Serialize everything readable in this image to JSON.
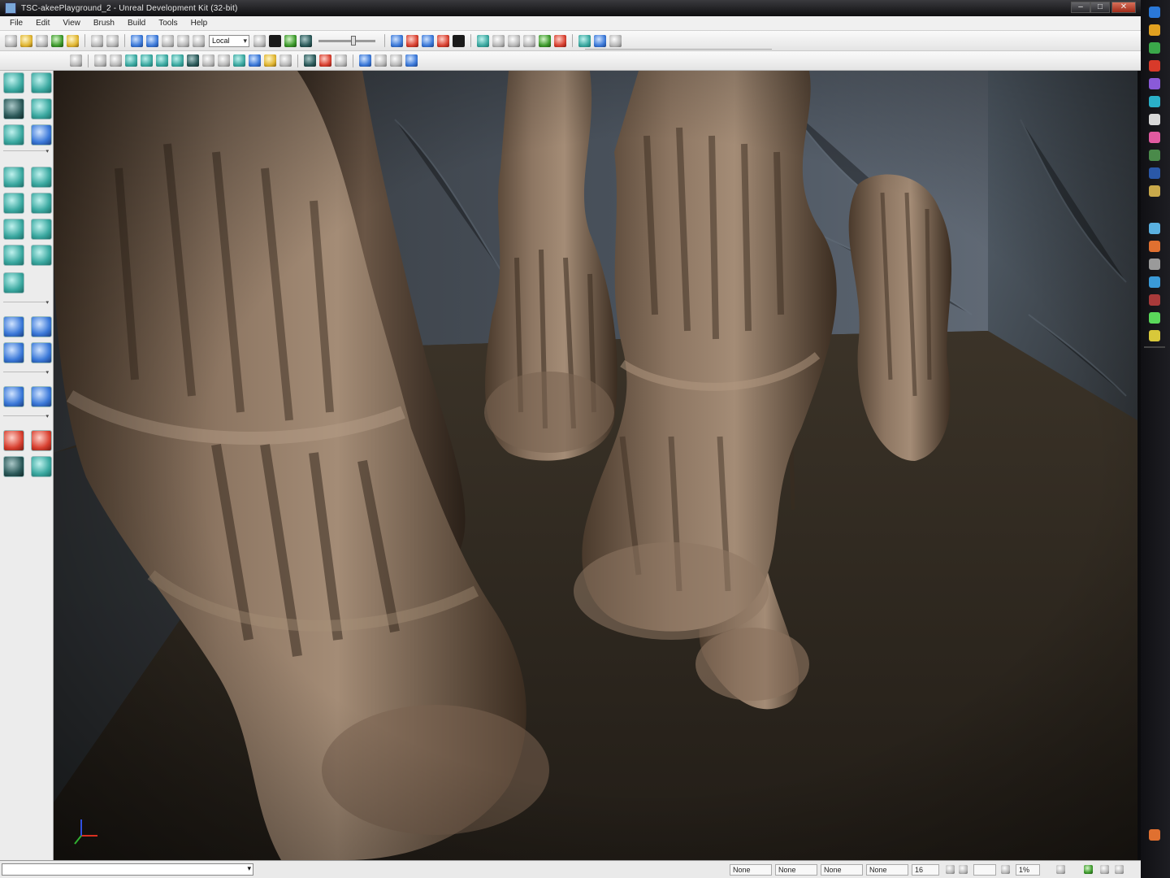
{
  "window": {
    "title": "TSC-akeePlayground_2 - Unreal Development Kit (32-bit)",
    "controls": {
      "minimize": "–",
      "maximize": "□",
      "close": "✕"
    }
  },
  "menubar": {
    "items": [
      "File",
      "Edit",
      "View",
      "Brush",
      "Build",
      "Tools",
      "Help"
    ]
  },
  "toolbar": {
    "view_combo": "Local"
  },
  "status": {
    "fields": [
      "None",
      "None",
      "None",
      "None"
    ],
    "grid_value": "16",
    "zoom_value": "1%"
  },
  "colors": {
    "accent": "#3aa8a0",
    "titlebar": "#1a1a1e",
    "panel": "#ececec"
  },
  "icons": {
    "left_tools": [
      "camera-mode-icon",
      "geometry-mode-icon",
      "terrain-mode-icon",
      "transform-widget-icon",
      "texture-align-icon",
      "mesh-paint-icon",
      "cube-brush-icon",
      "cone-brush-icon",
      "cylinder-brush-icon",
      "tetrahedron-brush-icon",
      "linear-stair-icon",
      "sheet-brush-icon",
      "curved-stair-icon",
      "sphere-brush-icon",
      "volumetric-brush-icon",
      "csg-add-icon",
      "csg-subtract-icon",
      "csg-intersect-icon",
      "csg-deintersect-icon",
      "add-volume-icon",
      "add-special-icon",
      "show-selected-icon",
      "hide-selected-icon",
      "select-inverse-icon",
      "show-all-icon"
    ]
  }
}
